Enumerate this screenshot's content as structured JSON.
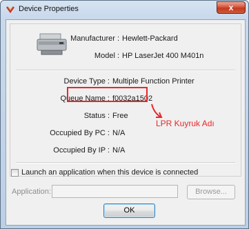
{
  "window": {
    "title": "Device Properties",
    "close_glyph": "x"
  },
  "device": {
    "manufacturer_label": "Manufacturer :",
    "manufacturer": "Hewlett-Packard",
    "model_label": "Model :",
    "model": "HP LaserJet 400 M401n",
    "icon": "printer-icon"
  },
  "fields": {
    "device_type_label": "Device Type :",
    "device_type": "Multiple Function Printer",
    "queue_name_label": "Queue Name :",
    "queue_name": "f0032a1502",
    "status_label": "Status :",
    "status": "Free",
    "occupied_pc_label": "Occupied By PC :",
    "occupied_pc": "N/A",
    "occupied_ip_label": "Occupied By IP :",
    "occupied_ip": "N/A"
  },
  "annotation": {
    "text": "LPR Kuyruk Adı",
    "color": "#e8262a"
  },
  "launch": {
    "checkbox_label": "Launch an application when this device is connected",
    "checked": false
  },
  "application": {
    "label": "Application:",
    "value": "",
    "browse_label": "Browse..."
  },
  "buttons": {
    "ok": "OK"
  }
}
